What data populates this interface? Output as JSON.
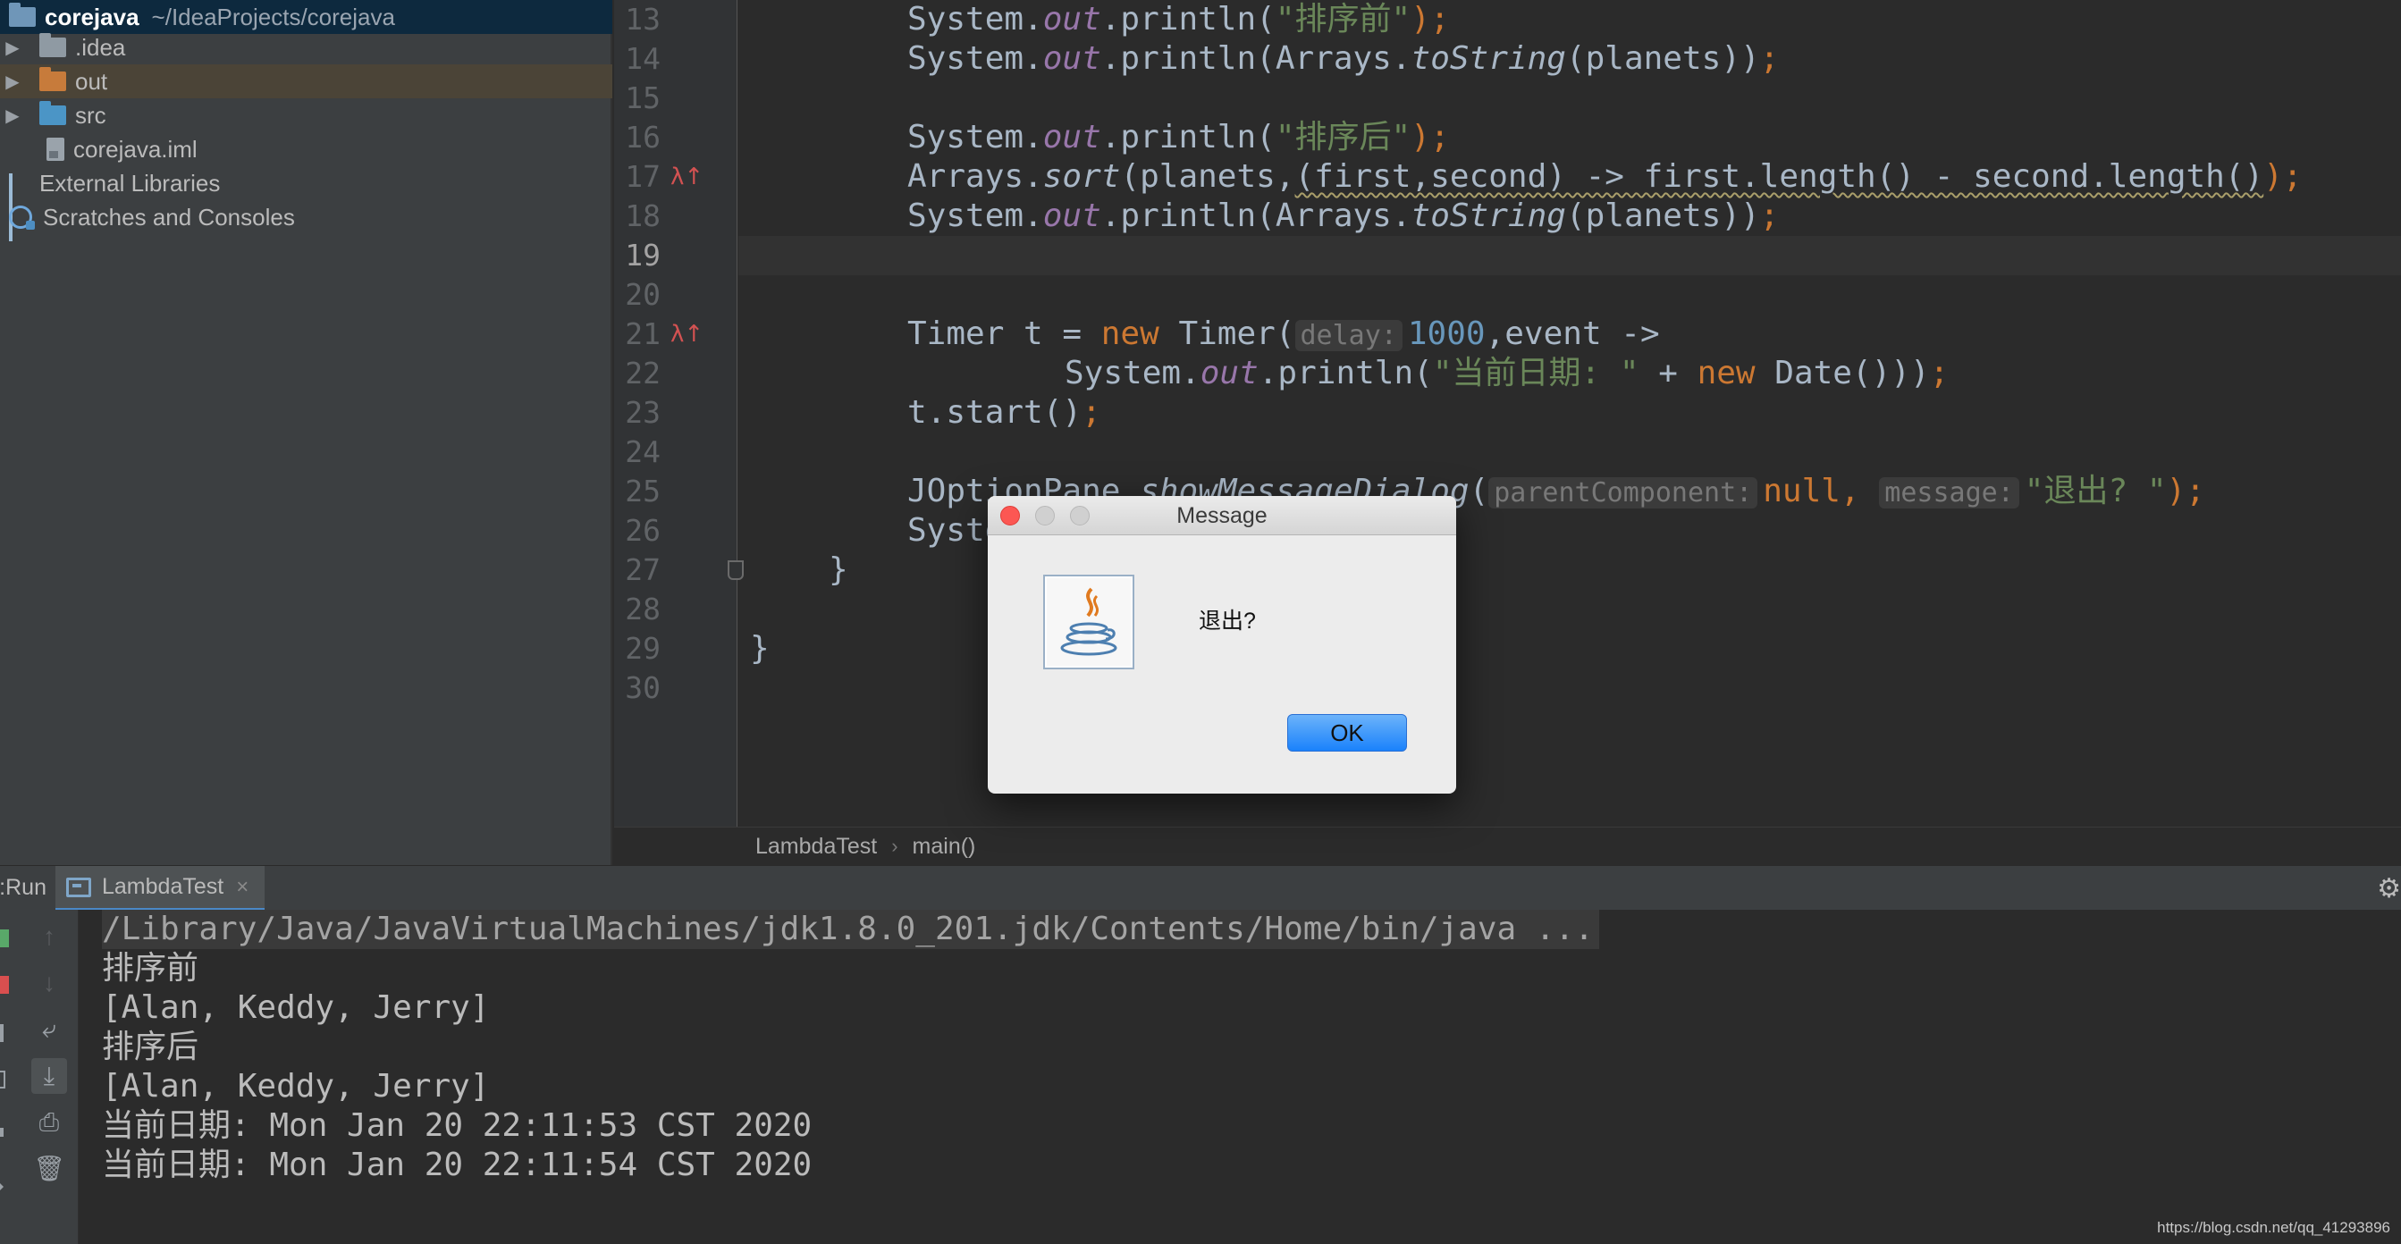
{
  "project": {
    "name": "corejava",
    "path": "~/IdeaProjects/corejava",
    "items": [
      {
        "label": ".idea"
      },
      {
        "label": "out"
      },
      {
        "label": "src"
      },
      {
        "label": "corejava.iml"
      },
      {
        "label": "External Libraries"
      },
      {
        "label": "Scratches and Consoles"
      }
    ]
  },
  "editor": {
    "line_numbers": [
      "13",
      "14",
      "15",
      "16",
      "17",
      "18",
      "19",
      "20",
      "21",
      "22",
      "23",
      "24",
      "25",
      "26",
      "27",
      "28",
      "29",
      "30"
    ],
    "code": {
      "l13": {
        "a": "System.",
        "out": "out",
        "b": ".println(",
        "s": "\"排序前\"",
        "end": ");"
      },
      "l14": {
        "a": "System.",
        "out": "out",
        "b": ".println(Arrays.",
        "m": "toString",
        "c": "(planets))",
        "end": ";"
      },
      "l16": {
        "a": "System.",
        "out": "out",
        "b": ".println(",
        "s": "\"排序后\"",
        "end": ");"
      },
      "l17": {
        "a": "Arrays.",
        "m": "sort",
        "b": "(planets,",
        "lambda": "(first,second) -> first.length() - second.length()",
        "end": ");"
      },
      "l18": {
        "a": "System.",
        "out": "out",
        "b": ".println(Arrays.",
        "m": "toString",
        "c": "(planets))",
        "end": ";"
      },
      "l21": {
        "a": "Timer t = ",
        "kw_new": "new",
        "b": " Timer(",
        "hint": "delay:",
        "num": "1000",
        "c": ",event ->"
      },
      "l22": {
        "a": "System.",
        "out": "out",
        "b": ".println(",
        "s": "\"当前日期: \"",
        "c": " + ",
        "kw_new": "new",
        "d": " Date()))",
        "end": ";"
      },
      "l23": {
        "a": "t.start()",
        "end": ";"
      },
      "l25": {
        "a": "JOptionPane.",
        "m": "showMessageDialog",
        "b": "(",
        "hint1": "parentComponent:",
        "kw_null": "null,",
        "hint2": "message:",
        "s": "\"退出? \"",
        "end": ");"
      },
      "l26": {
        "a": "System.exit(0);"
      },
      "l27": {
        "a": "}"
      },
      "l29": {
        "a": "}"
      }
    },
    "breadcrumb": [
      "LambdaTest",
      "main()"
    ]
  },
  "run": {
    "label": "Run:",
    "tab": "LambdaTest",
    "close_glyph": "×",
    "console": [
      "/Library/Java/JavaVirtualMachines/jdk1.8.0_201.jdk/Contents/Home/bin/java ...",
      "排序前",
      "[Alan, Keddy, Jerry]",
      "排序后",
      "[Alan, Keddy, Jerry]",
      "当前日期: Mon Jan 20 22:11:53 CST 2020",
      "当前日期: Mon Jan 20 22:11:54 CST 2020"
    ]
  },
  "dialog": {
    "title": "Message",
    "message": "退出?",
    "ok": "OK"
  },
  "watermark": "https://blog.csdn.net/qq_41293896",
  "colors": {
    "keyword": "#cc7832",
    "string": "#6a8759",
    "number": "#6897bb",
    "field": "#9876aa",
    "text": "#a9b7c6",
    "ok_button": "#1a82fb",
    "close_button": "#fc5753"
  }
}
